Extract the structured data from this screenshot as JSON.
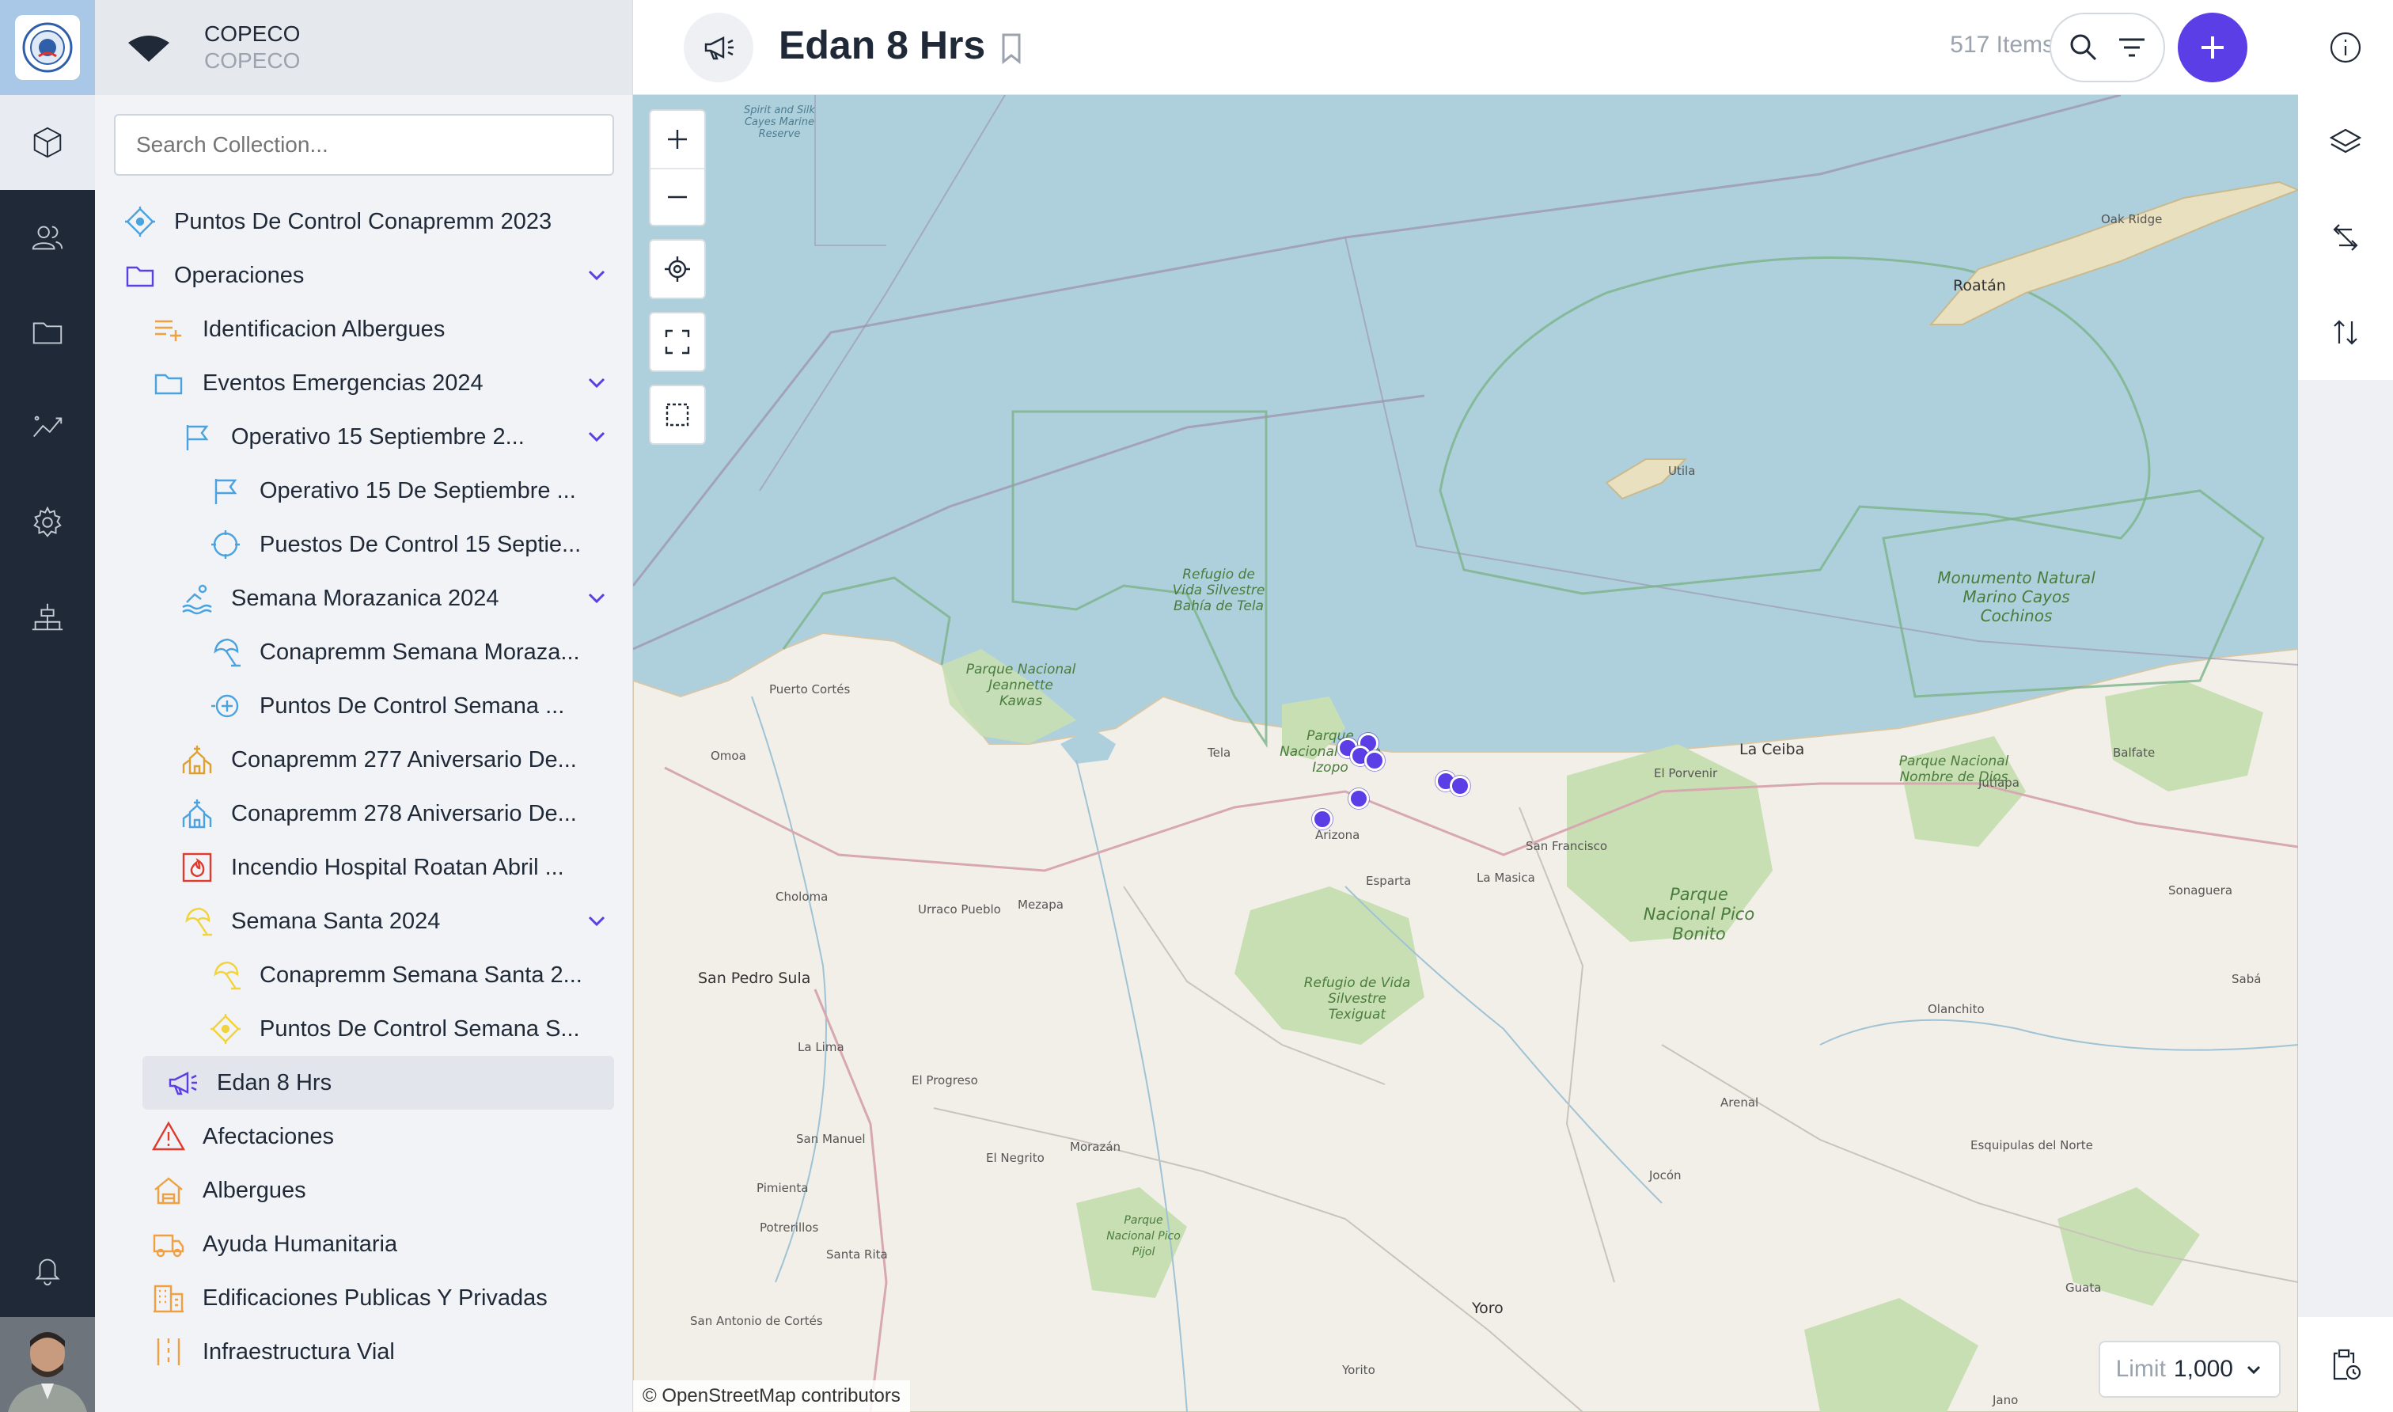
{
  "org": {
    "name": "COPECO",
    "subtitle": "COPECO"
  },
  "search": {
    "placeholder": "Search Collection..."
  },
  "tree": [
    {
      "label": "Puntos De Control Conapremm 2023",
      "icon": "diamond-target-icon",
      "color": "#4aa3df",
      "level": 0
    },
    {
      "label": "Operaciones",
      "icon": "folder-icon",
      "color": "#5b3ee6",
      "level": 0,
      "expanded": true
    },
    {
      "label": "Identificacion Albergues",
      "icon": "list-plus-icon",
      "color": "#f0a040",
      "level": 1
    },
    {
      "label": "Eventos Emergencias 2024",
      "icon": "folder-icon",
      "color": "#4aa3df",
      "level": 1,
      "expanded": true
    },
    {
      "label": "Operativo 15 Septiembre 2...",
      "icon": "flag-icon",
      "color": "#4aa3df",
      "level": 2,
      "expanded": true
    },
    {
      "label": "Operativo 15 De Septiembre ...",
      "icon": "flag-icon",
      "color": "#4aa3df",
      "level": 3
    },
    {
      "label": "Puestos De Control 15 Septie...",
      "icon": "crosshair-icon",
      "color": "#4aa3df",
      "level": 3
    },
    {
      "label": "Semana Morazanica 2024",
      "icon": "swimmer-icon",
      "color": "#4aa3df",
      "level": 2,
      "expanded": true
    },
    {
      "label": "Conapremm Semana Moraza...",
      "icon": "beach-umbrella-icon",
      "color": "#4aa3df",
      "level": 3
    },
    {
      "label": "Puntos De Control Semana ...",
      "icon": "plus-target-icon",
      "color": "#4aa3df",
      "level": 3
    },
    {
      "label": "Conapremm 277 Aniversario De...",
      "icon": "church-icon",
      "color": "#e0a030",
      "level": 2
    },
    {
      "label": "Conapremm 278 Aniversario De...",
      "icon": "church-icon",
      "color": "#4aa3df",
      "level": 2
    },
    {
      "label": "Incendio Hospital Roatan Abril ...",
      "icon": "fire-icon",
      "color": "#e03a2e",
      "level": 2
    },
    {
      "label": "Semana Santa 2024",
      "icon": "beach-umbrella-icon",
      "color": "#f2d33a",
      "level": 2,
      "expanded": true
    },
    {
      "label": "Conapremm Semana Santa 2...",
      "icon": "beach-umbrella-icon",
      "color": "#f2d33a",
      "level": 3
    },
    {
      "label": "Puntos De Control Semana S...",
      "icon": "diamond-target-icon",
      "color": "#f2d33a",
      "level": 3
    },
    {
      "label": "Edan 8 Hrs",
      "icon": "megaphone-icon",
      "color": "#5b3ee6",
      "level": 1,
      "selected": true
    },
    {
      "label": "Afectaciones",
      "icon": "warning-icon",
      "color": "#e03a2e",
      "level": 1
    },
    {
      "label": "Albergues",
      "icon": "shelter-icon",
      "color": "#f0a040",
      "level": 1
    },
    {
      "label": "Ayuda Humanitaria",
      "icon": "truck-icon",
      "color": "#f0a040",
      "level": 1
    },
    {
      "label": "Edificaciones Publicas Y Privadas",
      "icon": "building-icon",
      "color": "#f0a040",
      "level": 1
    },
    {
      "label": "Infraestructura Vial",
      "icon": "road-icon",
      "color": "#f0a040",
      "level": 1
    }
  ],
  "header": {
    "title": "Edan 8 Hrs",
    "items_count": "517 Items"
  },
  "map": {
    "attribution": "© OpenStreetMap contributors",
    "limit_label": "Limit",
    "limit_value": "1,000",
    "accent": "#5b3ee6",
    "places": {
      "roatan": "Roatán",
      "oak_ridge": "Oak Ridge",
      "utila": "Utila",
      "la_ceiba": "La Ceiba",
      "tela": "Tela",
      "arizona": "Arizona",
      "puerto_cortes": "Puerto Cortés",
      "omoa": "Omoa",
      "choloma": "Choloma",
      "urraco_pueblo": "Urraco Pueblo",
      "mezapa": "Mezapa",
      "san_pedro_sula": "San Pedro Sula",
      "la_lima": "La Lima",
      "el_progreso": "El Progreso",
      "san_manuel": "San Manuel",
      "pimienta": "Pimienta",
      "potrerillos": "Potrerillos",
      "santa_rita": "Santa Rita",
      "el_negrito": "El Negrito",
      "morazan": "Morazán",
      "yoro": "Yoro",
      "yorito": "Yorito",
      "jocon": "Jocón",
      "arenal": "Arenal",
      "olanchito": "Olanchito",
      "esquipulas": "Esquipulas del Norte",
      "saba": "Sabá",
      "sonaguera": "Sonaguera",
      "balfate": "Balfate",
      "jutiapa": "Jutiapa",
      "el_porvenir": "El Porvenir",
      "san_francisco": "San Francisco",
      "la_masica": "La Masica",
      "esparta": "Esparta",
      "san_antonio": "San Antonio de Cortés",
      "guata": "Guata",
      "jano": "Jano",
      "park_jeannette": "Parque Nacional Jeannette Kawas",
      "park_punta_izopo": "Parque Nacional Punta Izopo",
      "park_pico_bonito": "Parque Nacional Pico Bonito",
      "park_nombre_de_dios": "Parque Nacional Nombre de Dios",
      "park_texiguat": "Refugio de Vida Silvestre Texiguat",
      "refugio_bahia_tela": "Refugio de Vida Silvestre Bahía de Tela",
      "cayos_cochinos": "Monumento Natural Marino Cayos Cochinos",
      "spirit_silk": "Spirit and Silk Cayes Marine Reserve",
      "park_pico_pijol": "Parque Nacional Pico Pijol"
    }
  }
}
